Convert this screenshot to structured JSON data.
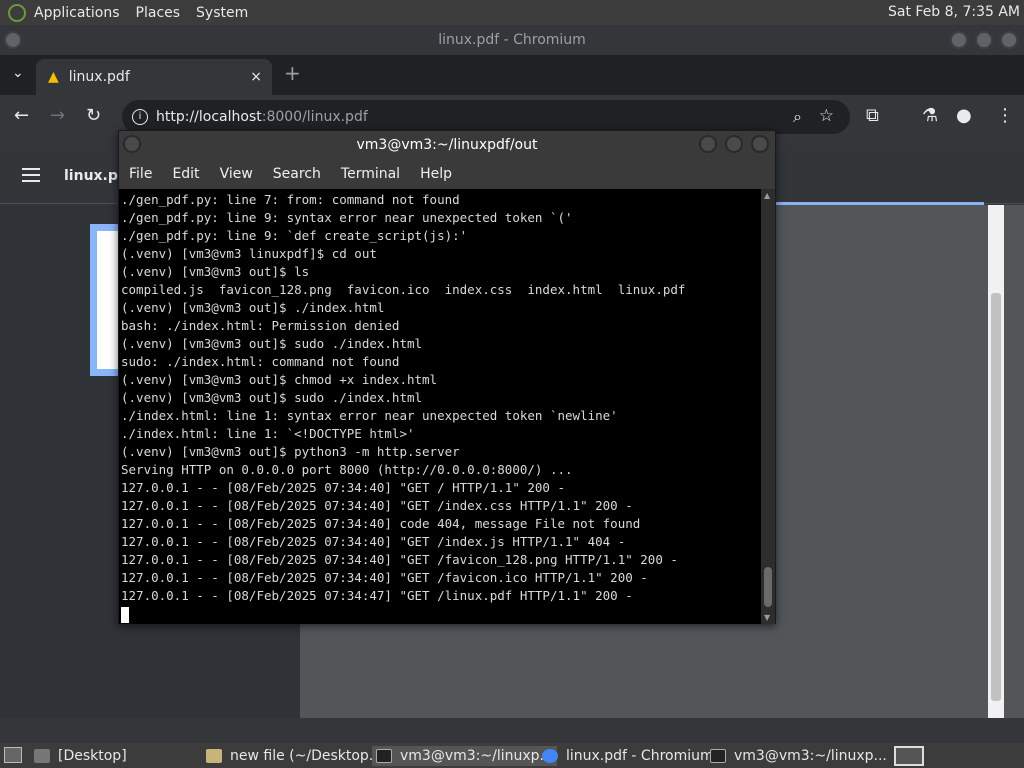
{
  "top_panel": {
    "menu": [
      "Applications",
      "Places",
      "System"
    ],
    "clock": "Sat Feb  8,  7:35 AM"
  },
  "chromium": {
    "window_title": "linux.pdf - Chromium",
    "tab_title": "linux.pdf",
    "tab_close": "×",
    "new_tab": "+",
    "url_host": "http://localhost",
    "url_rest": ":8000/linux.pdf",
    "pdf_title": "linux.pdf"
  },
  "terminal": {
    "title": "vm3@vm3:~/linuxpdf/out",
    "menu": [
      "File",
      "Edit",
      "View",
      "Search",
      "Terminal",
      "Help"
    ],
    "lines": [
      "./gen_pdf.py: line 7: from: command not found",
      "./gen_pdf.py: line 9: syntax error near unexpected token `('",
      "./gen_pdf.py: line 9: `def create_script(js):'",
      "(.venv) [vm3@vm3 linuxpdf]$ cd out",
      "(.venv) [vm3@vm3 out]$ ls",
      "compiled.js  favicon_128.png  favicon.ico  index.css  index.html  linux.pdf",
      "(.venv) [vm3@vm3 out]$ ./index.html",
      "bash: ./index.html: Permission denied",
      "(.venv) [vm3@vm3 out]$ sudo ./index.html",
      "sudo: ./index.html: command not found",
      "(.venv) [vm3@vm3 out]$ chmod +x index.html",
      "(.venv) [vm3@vm3 out]$ sudo ./index.html",
      "./index.html: line 1: syntax error near unexpected token `newline'",
      "./index.html: line 1: `<!DOCTYPE html>'",
      "(.venv) [vm3@vm3 out]$ python3 -m http.server",
      "Serving HTTP on 0.0.0.0 port 8000 (http://0.0.0.0:8000/) ...",
      "127.0.0.1 - - [08/Feb/2025 07:34:40] \"GET / HTTP/1.1\" 200 -",
      "127.0.0.1 - - [08/Feb/2025 07:34:40] \"GET /index.css HTTP/1.1\" 200 -",
      "127.0.0.1 - - [08/Feb/2025 07:34:40] code 404, message File not found",
      "127.0.0.1 - - [08/Feb/2025 07:34:40] \"GET /index.js HTTP/1.1\" 404 -",
      "127.0.0.1 - - [08/Feb/2025 07:34:40] \"GET /favicon_128.png HTTP/1.1\" 200 -",
      "127.0.0.1 - - [08/Feb/2025 07:34:40] \"GET /favicon.ico HTTP/1.1\" 200 -",
      "127.0.0.1 - - [08/Feb/2025 07:34:47] \"GET /linux.pdf HTTP/1.1\" 200 -"
    ]
  },
  "taskbar": {
    "items": [
      "[Desktop]",
      "new file (~/Desktop...",
      "vm3@vm3:~/linuxp...",
      "linux.pdf - Chromium",
      "vm3@vm3:~/linuxp..."
    ]
  }
}
